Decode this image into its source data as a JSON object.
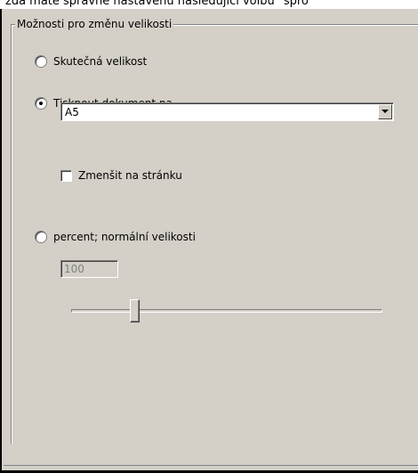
{
  "header": {
    "clipped_text": "zda máte správně nastavenu následující volbu \"spro"
  },
  "resize_options": {
    "group_label": "Možnosti pro změnu velikosti",
    "actual_size_label": "Skutečná velikost",
    "actual_size_selected": false,
    "print_on_label": "Tisknout dokument na",
    "print_on_selected": true,
    "paper_size": {
      "selected": "A5"
    },
    "shrink_to_page_label": "Zmenšit na stránku",
    "shrink_to_page_checked": false,
    "percent_label": "percent; normální velikosti",
    "percent_selected": false,
    "percent_value": "100",
    "slider_level_percent": 100
  }
}
